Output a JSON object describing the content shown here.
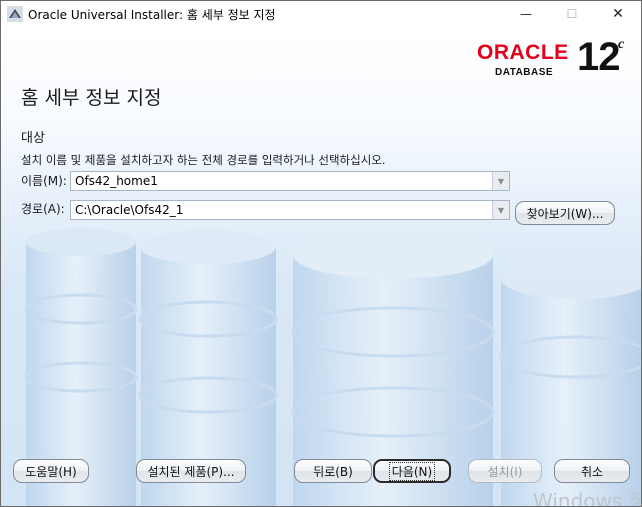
{
  "window": {
    "title": "Oracle Universal Installer: 홈 세부 정보 지정",
    "controls": {
      "minimize": "—",
      "maximize": "☐",
      "close": "✕"
    }
  },
  "logo": {
    "brand": "ORACLE",
    "product": "DATABASE",
    "version": "12",
    "version_suffix": "c",
    "brand_color": "#e4001b"
  },
  "page": {
    "title": "홈 세부 정보 지정",
    "section_label": "대상",
    "description": "설치 이름 및 제품을 설치하고자 하는 전체 경로를 입력하거나 선택하십시오."
  },
  "form": {
    "name_label": "이름(M):",
    "name_value": "Ofs42_home1",
    "path_label": "경로(A):",
    "path_value": "C:\\Oracle\\Ofs42_1",
    "browse_label": "찾아보기(W)..."
  },
  "footer": {
    "help_label": "도움말(H)",
    "installed_label": "설치된 제품(P)...",
    "back_label": "뒤로(B)",
    "next_label": "다음(N)",
    "install_label": "설치(I)",
    "cancel_label": "취소"
  },
  "watermark": "Windows 정"
}
